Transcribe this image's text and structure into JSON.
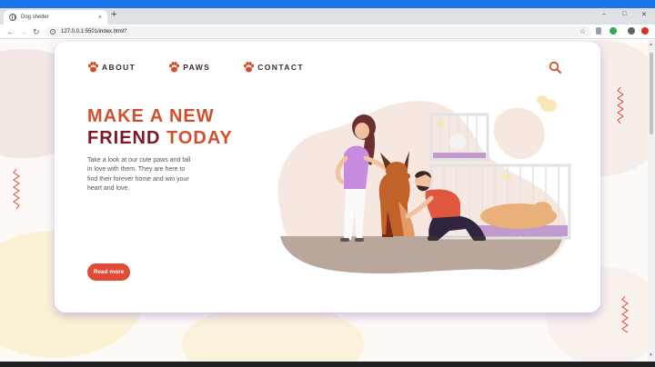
{
  "browser": {
    "tab_title": "Dog shelter",
    "tab_close": "×",
    "new_tab": "+",
    "url": "127.0.0.1:5501/index.html?",
    "min": "–",
    "max": "□",
    "close": "✕"
  },
  "nav": {
    "items": [
      {
        "label": "ABOUT"
      },
      {
        "label": "PAWS"
      },
      {
        "label": "CONTACT"
      }
    ]
  },
  "hero": {
    "title_line1": "MAKE A NEW",
    "title_line2a": "FRIEND",
    "title_line2b": "TODAY",
    "description": "Take a look at our cute paws and fall in love with them. They are here to find their forever home and win your heart and love.",
    "button_label": "Read more"
  },
  "colors": {
    "accent": "#e14a35",
    "title_orange": "#d0502d",
    "title_dark": "#7b1a22",
    "blob": "#f6e8e0"
  },
  "icons": {
    "nav": "paw-icon",
    "search": "search-icon"
  }
}
